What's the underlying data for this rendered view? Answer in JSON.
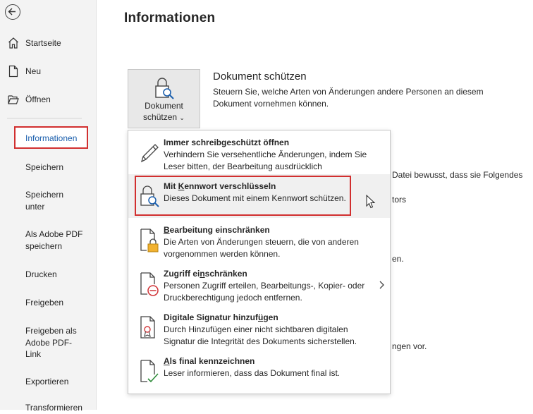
{
  "sidebar": {
    "items": [
      {
        "label": "Startseite",
        "icon": "home-icon"
      },
      {
        "label": "Neu",
        "icon": "new-document-icon"
      },
      {
        "label": "Öffnen",
        "icon": "open-folder-icon"
      },
      {
        "label": "Informationen"
      },
      {
        "label": "Speichern"
      },
      {
        "label": "Speichern unter"
      },
      {
        "label": "Als Adobe PDF speichern"
      },
      {
        "label": "Drucken"
      },
      {
        "label": "Freigeben"
      },
      {
        "label": "Freigeben als Adobe PDF-Link"
      },
      {
        "label": "Exportieren"
      },
      {
        "label": "Transformieren"
      }
    ]
  },
  "page": {
    "title": "Informationen"
  },
  "protect": {
    "button_line1": "Dokument",
    "button_line2": "schützen",
    "title": "Dokument schützen",
    "desc": "Steuern Sie, welche Arten von Änderungen andere Personen an diesem Dokument vornehmen können."
  },
  "background_fragments": [
    "Datei bewusst, dass sie Folgendes",
    "tors",
    "en.",
    "ngen vor."
  ],
  "menu": {
    "items": [
      {
        "title_pre": "Immer schreibgeschützt öffnen",
        "title_u": "",
        "title_post": "",
        "desc": "Verhindern Sie versehentliche Änderungen, indem Sie Leser bitten, der Bearbeitung ausdrücklich zuzustimmen."
      },
      {
        "title_pre": "Mit ",
        "title_u": "K",
        "title_post": "ennwort verschlüsseln",
        "desc": "Dieses Dokument mit einem Kennwort schützen."
      },
      {
        "title_pre": "",
        "title_u": "B",
        "title_post": "earbeitung einschränken",
        "desc": "Die Arten von Änderungen steuern, die von anderen vorgenommen werden können."
      },
      {
        "title_pre": "Zugriff ei",
        "title_u": "n",
        "title_post": "schränken",
        "desc": "Personen Zugriff erteilen, Bearbeitungs-, Kopier- oder Druckberechtigung jedoch entfernen."
      },
      {
        "title_pre": "Digitale Signatur hinzuf",
        "title_u": "ü",
        "title_post": "gen",
        "desc": "Durch Hinzufügen einer nicht sichtbaren digitalen Signatur die Integrität des Dokuments sicherstellen."
      },
      {
        "title_pre": "",
        "title_u": "A",
        "title_post": "ls final kennzeichnen",
        "desc": "Leser informieren, dass das Dokument final ist."
      }
    ]
  },
  "colors": {
    "accent_blue": "#1b5fad",
    "highlight_red": "#d12f2f",
    "sidebar_bg": "#f3f3f3"
  }
}
